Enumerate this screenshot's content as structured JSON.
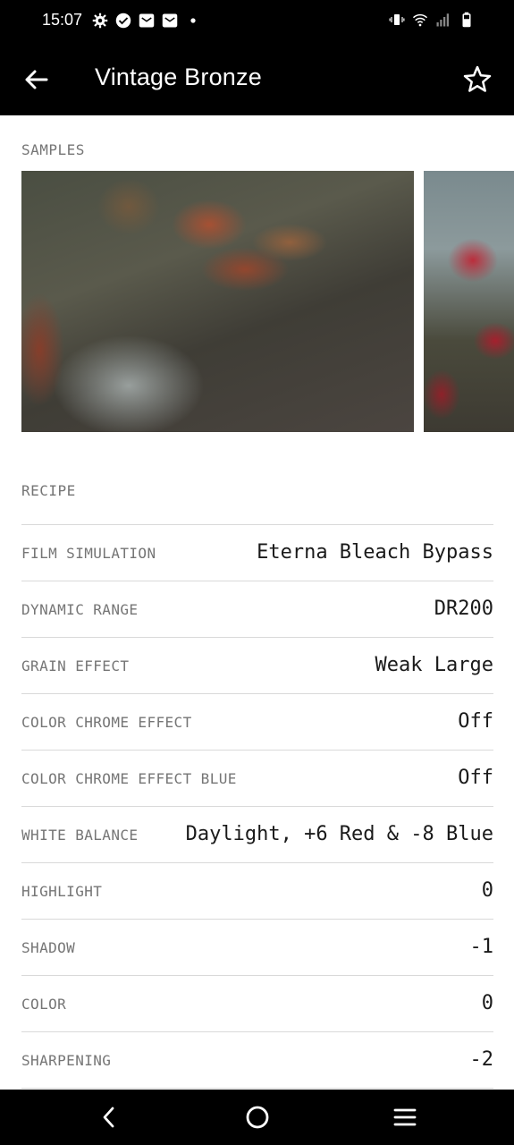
{
  "status_bar": {
    "time": "15:07",
    "left_icons": [
      "gear-icon",
      "check-circle-icon",
      "mail-icon",
      "mail-icon",
      "dot-icon"
    ],
    "right_icons": [
      "vibrate-icon",
      "wifi-icon",
      "signal-icon",
      "battery-icon"
    ]
  },
  "app_bar": {
    "title": "Vintage Bronze",
    "back_icon": "arrow-left-icon",
    "favorite_icon": "star-outline-icon"
  },
  "samples": {
    "label": "SAMPLES"
  },
  "recipe": {
    "label": "RECIPE",
    "rows": [
      {
        "label": "FILM SIMULATION",
        "value": "Eterna Bleach Bypass"
      },
      {
        "label": "DYNAMIC RANGE",
        "value": "DR200"
      },
      {
        "label": "GRAIN EFFECT",
        "value": "Weak Large"
      },
      {
        "label": "COLOR CHROME EFFECT",
        "value": "Off"
      },
      {
        "label": "COLOR CHROME EFFECT BLUE",
        "value": "Off"
      },
      {
        "label": "WHITE BALANCE",
        "value": "Daylight, +6 Red & -8 Blue"
      },
      {
        "label": "HIGHLIGHT",
        "value": "0"
      },
      {
        "label": "SHADOW",
        "value": "-1"
      },
      {
        "label": "COLOR",
        "value": "0"
      },
      {
        "label": "SHARPENING",
        "value": "-2"
      }
    ]
  },
  "nav_bar": {
    "icons": [
      "back-chevron-icon",
      "home-circle-icon",
      "menu-lines-icon"
    ]
  }
}
